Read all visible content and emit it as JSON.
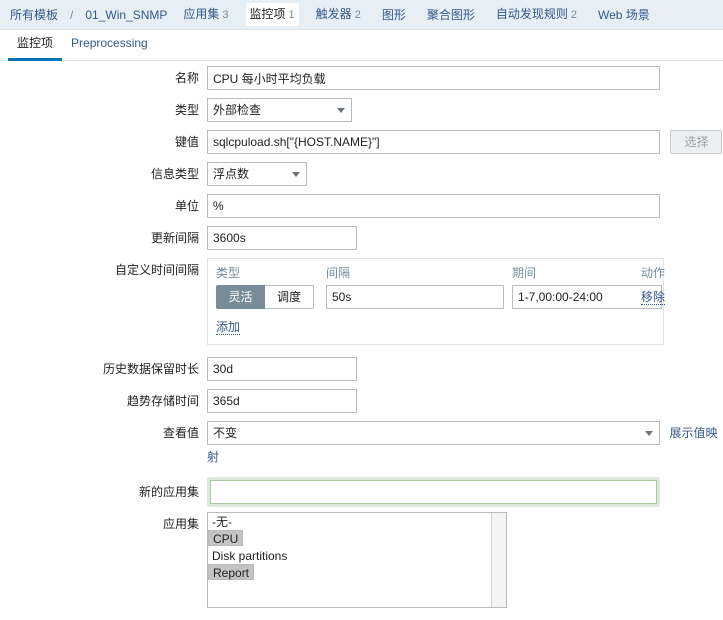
{
  "breadcrumb": {
    "root": "所有模板",
    "separator": "/",
    "template": "01_Win_SNMP"
  },
  "nav": {
    "items": [
      {
        "label": "应用集",
        "count": "3",
        "active": false
      },
      {
        "label": "监控项",
        "count": "1",
        "active": true
      },
      {
        "label": "触发器",
        "count": "2",
        "active": false
      },
      {
        "label": "图形",
        "count": "",
        "active": false
      },
      {
        "label": "聚合图形",
        "count": "",
        "active": false
      },
      {
        "label": "自动发现规则",
        "count": "2",
        "active": false
      },
      {
        "label": "Web 场景",
        "count": "",
        "active": false
      }
    ]
  },
  "tabs": [
    {
      "label": "监控项",
      "active": true
    },
    {
      "label": "Preprocessing",
      "active": false
    }
  ],
  "form": {
    "name": {
      "label": "名称",
      "value": "CPU 每小时平均负载"
    },
    "type": {
      "label": "类型",
      "value": "外部检查"
    },
    "key": {
      "label": "键值",
      "value": "sqlcpuload.sh[\"{HOST.NAME}\"]",
      "button": "选择"
    },
    "value_type": {
      "label": "信息类型",
      "value": "浮点数"
    },
    "units": {
      "label": "单位",
      "value": "%"
    },
    "interval": {
      "label": "更新间隔",
      "value": "3600s"
    },
    "custom_intervals": {
      "label": "自定义时间间隔",
      "headers": {
        "type": "类型",
        "interval": "间隔",
        "period": "期间",
        "action": "动作"
      },
      "rows": [
        {
          "type_flexible": "灵活",
          "type_scheduling": "调度",
          "type_selected": "灵活",
          "interval": "50s",
          "period": "1-7,00:00-24:00",
          "remove": "移除"
        }
      ],
      "add": "添加"
    },
    "history": {
      "label": "历史数据保留时长",
      "value": "30d"
    },
    "trends": {
      "label": "趋势存储时间",
      "value": "365d"
    },
    "show_value": {
      "label": "查看值",
      "value": "不变",
      "link": "展示值映射"
    },
    "new_application": {
      "label": "新的应用集",
      "value": "",
      "placeholder": ""
    },
    "applications": {
      "label": "应用集",
      "options": [
        {
          "label": "-无-",
          "selected": false
        },
        {
          "label": "CPU",
          "selected": true
        },
        {
          "label": "Disk partitions",
          "selected": false
        },
        {
          "label": "Report",
          "selected": true
        }
      ]
    }
  },
  "colors": {
    "nav_bg": "#e8eff4",
    "link": "#31598c",
    "muted": "#768d99",
    "tab_active_underline": "#0275b8",
    "segment_active_bg": "#768d99",
    "focus_green": "#dcebd9",
    "option_selected": "#c4c4c4"
  }
}
